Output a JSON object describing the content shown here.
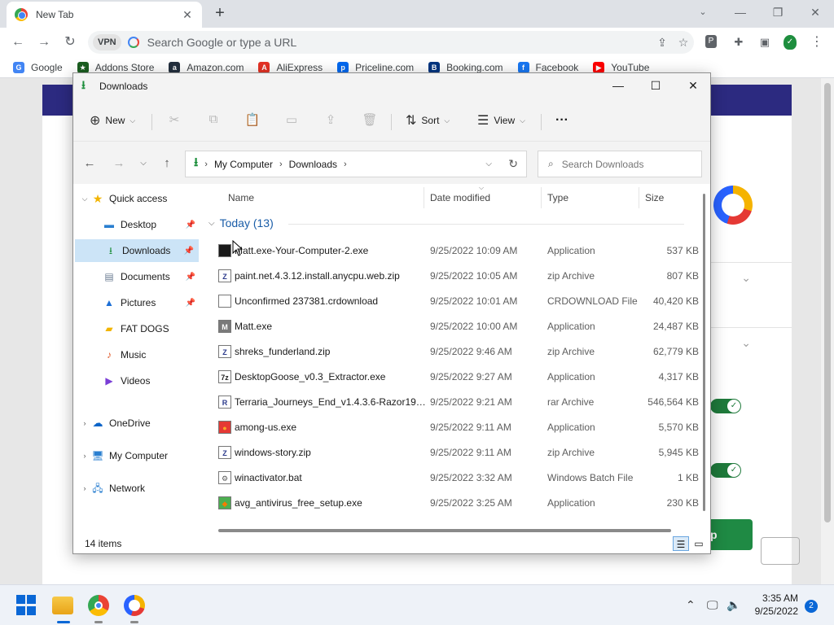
{
  "browser": {
    "tab_title": "New Tab",
    "tab_close": "✕",
    "new_tab": "+",
    "omnibox_placeholder": "Search Google or type a URL",
    "vpn_label": "VPN",
    "bookmarks": [
      {
        "label": "Google",
        "color": "#4285f4",
        "glyph": "G"
      },
      {
        "label": "Addons Store",
        "color": "#1b5e20",
        "glyph": "★"
      },
      {
        "label": "Amazon.com",
        "color": "#232f3e",
        "glyph": "a"
      },
      {
        "label": "AliExpress",
        "color": "#e43225",
        "glyph": "A"
      },
      {
        "label": "Priceline.com",
        "color": "#0068ef",
        "glyph": "p"
      },
      {
        "label": "Booking.com",
        "color": "#003580",
        "glyph": "B"
      },
      {
        "label": "Facebook",
        "color": "#1877f2",
        "glyph": "f"
      },
      {
        "label": "YouTube",
        "color": "#ff0000",
        "glyph": "▶"
      }
    ]
  },
  "explorer": {
    "title": "Downloads",
    "toolbar": {
      "new_label": "New",
      "sort_label": "Sort",
      "view_label": "View",
      "more_label": "···"
    },
    "breadcrumb": [
      "My Computer",
      "Downloads"
    ],
    "search_placeholder": "Search Downloads",
    "nav": {
      "quick_access": "Quick access",
      "items": [
        {
          "label": "Desktop",
          "icon": "desktop-icon",
          "pinned": true
        },
        {
          "label": "Downloads",
          "icon": "download-icon",
          "pinned": true,
          "selected": true
        },
        {
          "label": "Documents",
          "icon": "document-icon",
          "pinned": true
        },
        {
          "label": "Pictures",
          "icon": "pictures-icon",
          "pinned": true
        },
        {
          "label": "FAT DOGS",
          "icon": "folder-icon",
          "pinned": false
        },
        {
          "label": "Music",
          "icon": "music-icon",
          "pinned": false
        },
        {
          "label": "Videos",
          "icon": "videos-icon",
          "pinned": false
        }
      ],
      "onedrive": "OneDrive",
      "my_computer": "My Computer",
      "network": "Network"
    },
    "columns": {
      "name": "Name",
      "date": "Date modified",
      "type": "Type",
      "size": "Size"
    },
    "group_label": "Today (13)",
    "files": [
      {
        "name": "Matt.exe-Your-Computer-2.exe",
        "date": "9/25/2022 10:09 AM",
        "type": "Application",
        "size": "537 KB",
        "icon": "black-square-icon"
      },
      {
        "name": "paint.net.4.3.12.install.anycpu.web.zip",
        "date": "9/25/2022 10:05 AM",
        "type": "zip Archive",
        "size": "807 KB",
        "icon": "zip-icon"
      },
      {
        "name": "Unconfirmed 237381.crdownload",
        "date": "9/25/2022 10:01 AM",
        "type": "CRDOWNLOAD File",
        "size": "40,420 KB",
        "icon": "blank-file-icon"
      },
      {
        "name": "Matt.exe",
        "date": "9/25/2022 10:00 AM",
        "type": "Application",
        "size": "24,487 KB",
        "icon": "app-icon"
      },
      {
        "name": "shreks_funderland.zip",
        "date": "9/25/2022 9:46 AM",
        "type": "zip Archive",
        "size": "62,779 KB",
        "icon": "zip-icon"
      },
      {
        "name": "DesktopGoose_v0.3_Extractor.exe",
        "date": "9/25/2022 9:27 AM",
        "type": "Application",
        "size": "4,317 KB",
        "icon": "7z-icon"
      },
      {
        "name": "Terraria_Journeys_End_v1.4.3.6-Razor1911...",
        "date": "9/25/2022 9:21 AM",
        "type": "rar Archive",
        "size": "546,564 KB",
        "icon": "rar-icon"
      },
      {
        "name": "among-us.exe",
        "date": "9/25/2022 9:11 AM",
        "type": "Application",
        "size": "5,570 KB",
        "icon": "among-us-icon"
      },
      {
        "name": "windows-story.zip",
        "date": "9/25/2022 9:11 AM",
        "type": "zip Archive",
        "size": "5,945 KB",
        "icon": "zip-icon"
      },
      {
        "name": "winactivator.bat",
        "date": "9/25/2022 3:32 AM",
        "type": "Windows Batch File",
        "size": "1 KB",
        "icon": "bat-icon"
      },
      {
        "name": "avg_antivirus_free_setup.exe",
        "date": "9/25/2022 3:25 AM",
        "type": "Application",
        "size": "230 KB",
        "icon": "avg-icon"
      }
    ],
    "status_items": "14 items"
  },
  "taskbar": {
    "time": "3:35 AM",
    "date": "9/25/2022",
    "notification_count": "2"
  },
  "colors": {
    "selection": "#cce4f7",
    "group_header": "#1a5da8",
    "accent_green": "#1e8f3d"
  }
}
